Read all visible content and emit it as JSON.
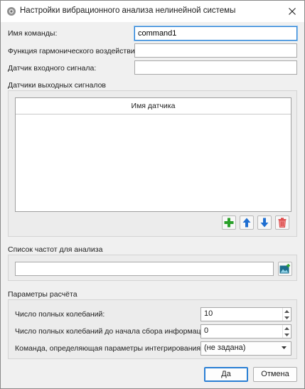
{
  "window": {
    "title": "Настройки вибрационного анализа нелинейной системы"
  },
  "fields": {
    "command_name": {
      "label": "Имя команды:",
      "value": "command1"
    },
    "harmonic_function": {
      "label": "Функция гармонического воздействия:",
      "value": ""
    },
    "input_sensor": {
      "label": "Датчик входного сигнала:",
      "value": ""
    }
  },
  "output_sensors": {
    "title": "Датчики выходных сигналов",
    "column_header": "Имя датчика",
    "rows": []
  },
  "frequency_list": {
    "title": "Список частот для анализа",
    "value": ""
  },
  "calc_params": {
    "title": "Параметры расчёта",
    "full_oscillations": {
      "label": "Число полных колебаний:",
      "value": "10"
    },
    "oscillations_before_collect": {
      "label": "Число полных колебаний до начала сбора информации:",
      "value": "0"
    },
    "integration_command": {
      "label": "Команда, определяющая параметры интегрирования:",
      "value": "(не задана)"
    }
  },
  "buttons": {
    "ok": "Да",
    "cancel": "Отмена"
  },
  "colors": {
    "accent": "#2a7fd4",
    "add": "#2aa02a",
    "move": "#1f6fd1",
    "delete": "#e04b4b"
  },
  "icons": {
    "app": "gear-app-icon",
    "close": "close-icon",
    "add": "plus-icon",
    "up": "arrow-up-icon",
    "down": "arrow-down-icon",
    "delete": "trash-icon",
    "edit_frequency": "image-edit-icon"
  }
}
